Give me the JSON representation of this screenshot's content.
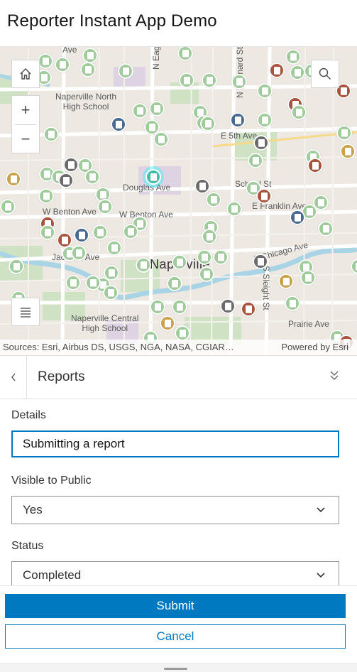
{
  "app": {
    "title": "Reporter Instant App Demo"
  },
  "map": {
    "labels": {
      "school_north": "Naperville North\nHigh School",
      "school_central": "Naperville Central\nHigh School",
      "city": "Naperville",
      "douglas": "Douglas Ave",
      "benton_w": "W Benton Ave",
      "benton_w2": "W Benton Ave",
      "jackson": "Jackson Ave",
      "school_st": "School St",
      "franklin": "E Franklin Ave",
      "chicago": "E Chicago Ave",
      "fifth": "E 5th Ave",
      "prairie": "Prairie Ave",
      "eagle": "N Eagle St",
      "brainard": "N Brainard St",
      "sleight": "S Sleight St",
      "ave_top": "Ave"
    },
    "attribution": "Sources: Esri, Airbus DS, USGS, NGA, NASA, CGIAR…",
    "powered_by": "Powered by Esri",
    "zoom_in": "+",
    "zoom_out": "−"
  },
  "panel": {
    "title": "Reports",
    "back_icon": "chevron-left-icon",
    "collapse_icon": "chevrons-down-icon"
  },
  "form": {
    "details_label": "Details",
    "details_value": "Submitting a report",
    "visible_label": "Visible to Public",
    "visible_value": "Yes",
    "status_label": "Status",
    "status_value": "Completed"
  },
  "actions": {
    "submit": "Submit",
    "cancel": "Cancel"
  },
  "colors": {
    "accent": "#0079c1",
    "pin_green": "#9fcc9a",
    "pin_navy": "#4a6991",
    "pin_gray": "#6b6b6b",
    "pin_red": "#a8543f",
    "pin_gold": "#caa24a",
    "pin_selected": "#3fbfa8"
  }
}
